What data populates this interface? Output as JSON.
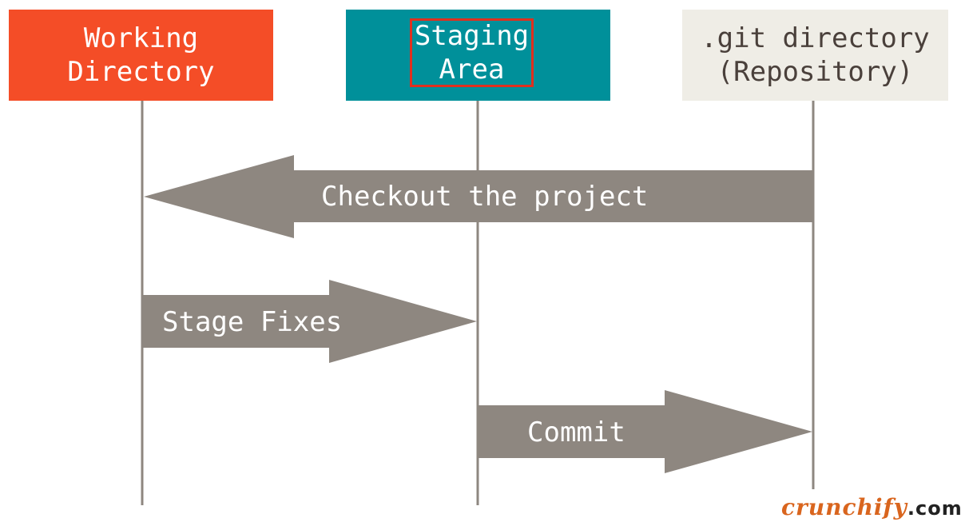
{
  "colors": {
    "working_directory": "#f44d27",
    "staging_area": "#00909a",
    "repository": "#efede6",
    "repository_text": "#4a403b",
    "arrow": "#8e8780",
    "lifeline": "#8e8780",
    "highlight": "#e0301e",
    "logo_orange": "#d9651e"
  },
  "columns": [
    {
      "id": "working-directory",
      "label": "Working\nDirectory"
    },
    {
      "id": "staging-area",
      "label": "Staging\nArea",
      "highlighted": true
    },
    {
      "id": "repository",
      "label": ".git directory\n(Repository)"
    }
  ],
  "arrows": [
    {
      "label": "Checkout the project",
      "from": "repository",
      "to": "working-directory"
    },
    {
      "label": "Stage Fixes",
      "from": "working-directory",
      "to": "staging-area"
    },
    {
      "label": "Commit",
      "from": "staging-area",
      "to": "repository"
    }
  ],
  "watermark": {
    "brand": "crunchify",
    "tld": ".com"
  }
}
